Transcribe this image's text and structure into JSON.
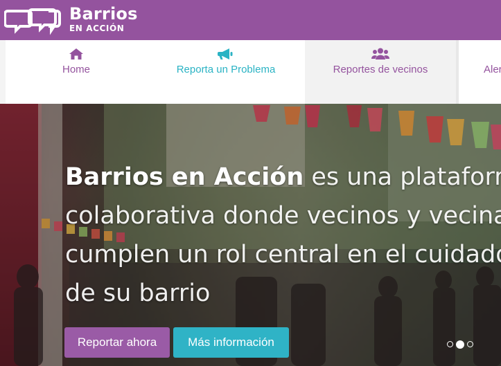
{
  "header": {
    "logo_title": "Barrios",
    "logo_subtitle": "EN ACCIÓN",
    "background": "#94539e"
  },
  "nav": {
    "items": [
      {
        "label": "Home",
        "icon": "home-icon",
        "color": "#94539e"
      },
      {
        "label": "Reporta un Problema",
        "icon": "megaphone-icon",
        "color": "#2ab3c4"
      },
      {
        "label": "Reportes de vecinos",
        "icon": "users-icon",
        "color": "#94539e"
      },
      {
        "label": "Alertas",
        "icon": "",
        "color": "#94539e"
      }
    ]
  },
  "hero": {
    "brand": "Barrios en Acción",
    "line1_rest": " es una plataforma",
    "line2": "colaborativa donde vecinos y vecinas",
    "line3": "cumplen un rol central en el cuidado",
    "line4": "de su barrio",
    "buttons": {
      "report": "Reportar ahora",
      "info": "Más información"
    },
    "carousel": {
      "count": 3,
      "active": 2
    }
  }
}
